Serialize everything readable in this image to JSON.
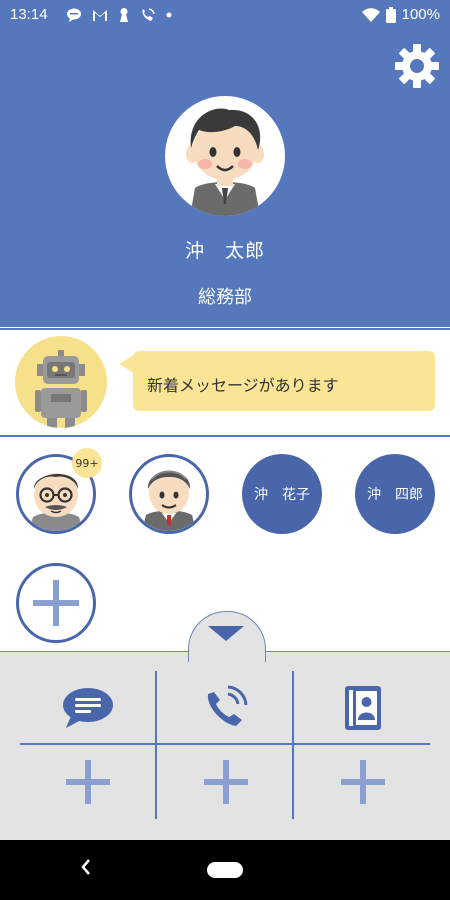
{
  "status_bar": {
    "time": "13:14",
    "battery": "100%",
    "icons_left": [
      "chat-bubble-icon",
      "gmail-icon",
      "keyhole-icon",
      "phone-signal-icon",
      "dot-icon"
    ],
    "icons_right": [
      "wifi-icon",
      "battery-icon"
    ]
  },
  "header": {
    "user_name": "沖　太郎",
    "department": "総務部",
    "background_color": "#5577bb",
    "settings_icon": "gear-icon"
  },
  "assistant": {
    "message": "新着メッセージがあります",
    "bubble_color": "#fae597"
  },
  "contacts": [
    {
      "type": "photo",
      "avatar": "grandpa-glasses",
      "badge": "99+"
    },
    {
      "type": "photo",
      "avatar": "grandma"
    },
    {
      "type": "name",
      "label": "沖　花子"
    },
    {
      "type": "name",
      "label": "沖　四郎"
    }
  ],
  "add_contact": {
    "icon": "plus-icon"
  },
  "tray": {
    "toggle_icon": "triangle-down-icon",
    "apps": [
      "message-icon",
      "phone-call-icon",
      "contacts-book-icon"
    ],
    "empty_slots": [
      "plus-icon",
      "plus-icon",
      "plus-icon"
    ]
  },
  "nav": {
    "back_icon": "back-icon",
    "home_icon": "home-pill-icon"
  },
  "colors": {
    "accent": "#4a66aa",
    "header": "#5577bb",
    "tray": "#e3e3e3"
  }
}
